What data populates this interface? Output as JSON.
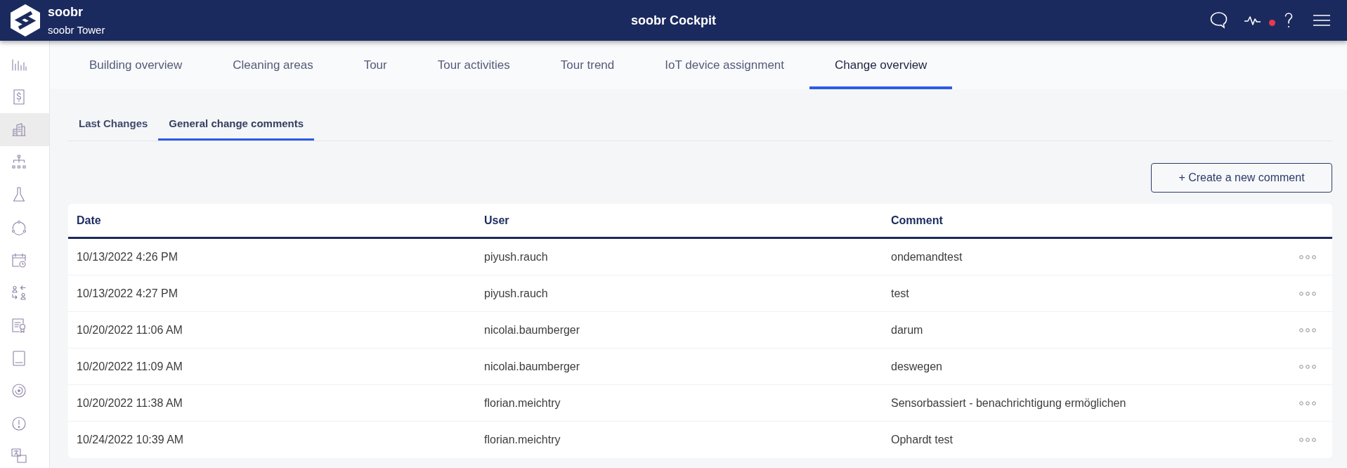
{
  "header": {
    "brand": "soobr",
    "site": "soobr Tower",
    "title": "soobr Cockpit",
    "activity_alert": true
  },
  "sidebar": {
    "items": [
      {
        "selected": false
      },
      {
        "selected": false
      },
      {
        "selected": true
      },
      {
        "selected": false
      },
      {
        "selected": false
      },
      {
        "selected": false
      },
      {
        "selected": false
      },
      {
        "selected": false
      },
      {
        "selected": false
      },
      {
        "selected": false
      },
      {
        "selected": false
      },
      {
        "selected": false
      },
      {
        "selected": false
      }
    ]
  },
  "tabs": [
    {
      "label": "Building overview",
      "selected": false
    },
    {
      "label": "Cleaning areas",
      "selected": false
    },
    {
      "label": "Tour",
      "selected": false
    },
    {
      "label": "Tour activities",
      "selected": false
    },
    {
      "label": "Tour trend",
      "selected": false
    },
    {
      "label": "IoT device assignment",
      "selected": false
    },
    {
      "label": "Change overview",
      "selected": true
    }
  ],
  "subtabs": [
    {
      "label": "Last Changes",
      "selected": false
    },
    {
      "label": "General change comments",
      "selected": true
    }
  ],
  "create_button": {
    "label": "+ Create a new comment"
  },
  "table": {
    "columns": [
      "Date",
      "User",
      "Comment"
    ],
    "rows": [
      [
        "10/13/2022 4:26 PM",
        "piyush.rauch",
        "ondemandtest"
      ],
      [
        "10/13/2022 4:27 PM",
        "piyush.rauch",
        "test"
      ],
      [
        "10/20/2022 11:06 AM",
        "nicolai.baumberger",
        "darum"
      ],
      [
        "10/20/2022 11:09 AM",
        "nicolai.baumberger",
        "deswegen"
      ],
      [
        "10/20/2022 11:38 AM",
        "florian.meichtry",
        "Sensorbassiert - benachrichtigung ermöglichen"
      ],
      [
        "10/24/2022 10:39 AM",
        "florian.meichtry",
        "Ophardt test"
      ]
    ]
  }
}
